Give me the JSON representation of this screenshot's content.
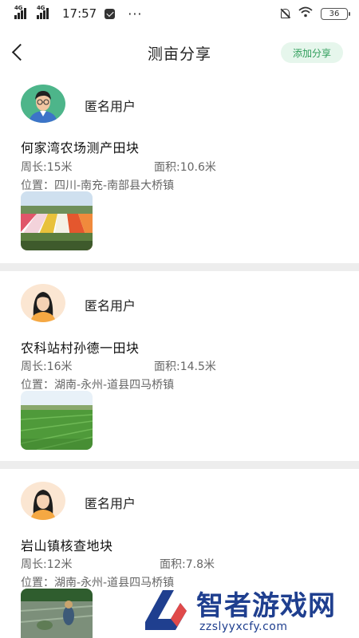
{
  "status_bar": {
    "signal1": "4G",
    "signal2": "4G",
    "time": "17:57",
    "more": "···",
    "battery": "36"
  },
  "nav": {
    "title": "测亩分享",
    "add_button": "添加分享"
  },
  "posts": [
    {
      "user": "匿名用户",
      "title": "何家湾农场测产田块",
      "perimeter": "周长:15米",
      "area": "面积:10.6米",
      "location": "位置：四川-南充-南部县大桥镇",
      "avatar_icon": "male-avatar-icon",
      "image": "tulip-field-image"
    },
    {
      "user": "匿名用户",
      "title": "农科站村孙德一田块",
      "perimeter": "周长:16米",
      "area": "面积:14.5米",
      "location": "位置：湖南-永州-道县四马桥镇",
      "avatar_icon": "female-avatar-icon",
      "image": "green-paddy-image"
    },
    {
      "user": "匿名用户",
      "title": "岩山镇核查地块",
      "perimeter": "周长:12米",
      "area": "面积:7.8米",
      "location": "位置：湖南-永州-道县四马桥镇",
      "avatar_icon": "female-avatar-icon",
      "image": "rice-planting-image"
    }
  ],
  "watermark": {
    "name": "智者游戏网",
    "url": "zzslyyxcfy.com"
  },
  "colors": {
    "accent_green": "#2e9d5a",
    "button_bg": "#e6f6ec",
    "separator": "#ededed",
    "watermark_blue": "#1f3f8f"
  }
}
